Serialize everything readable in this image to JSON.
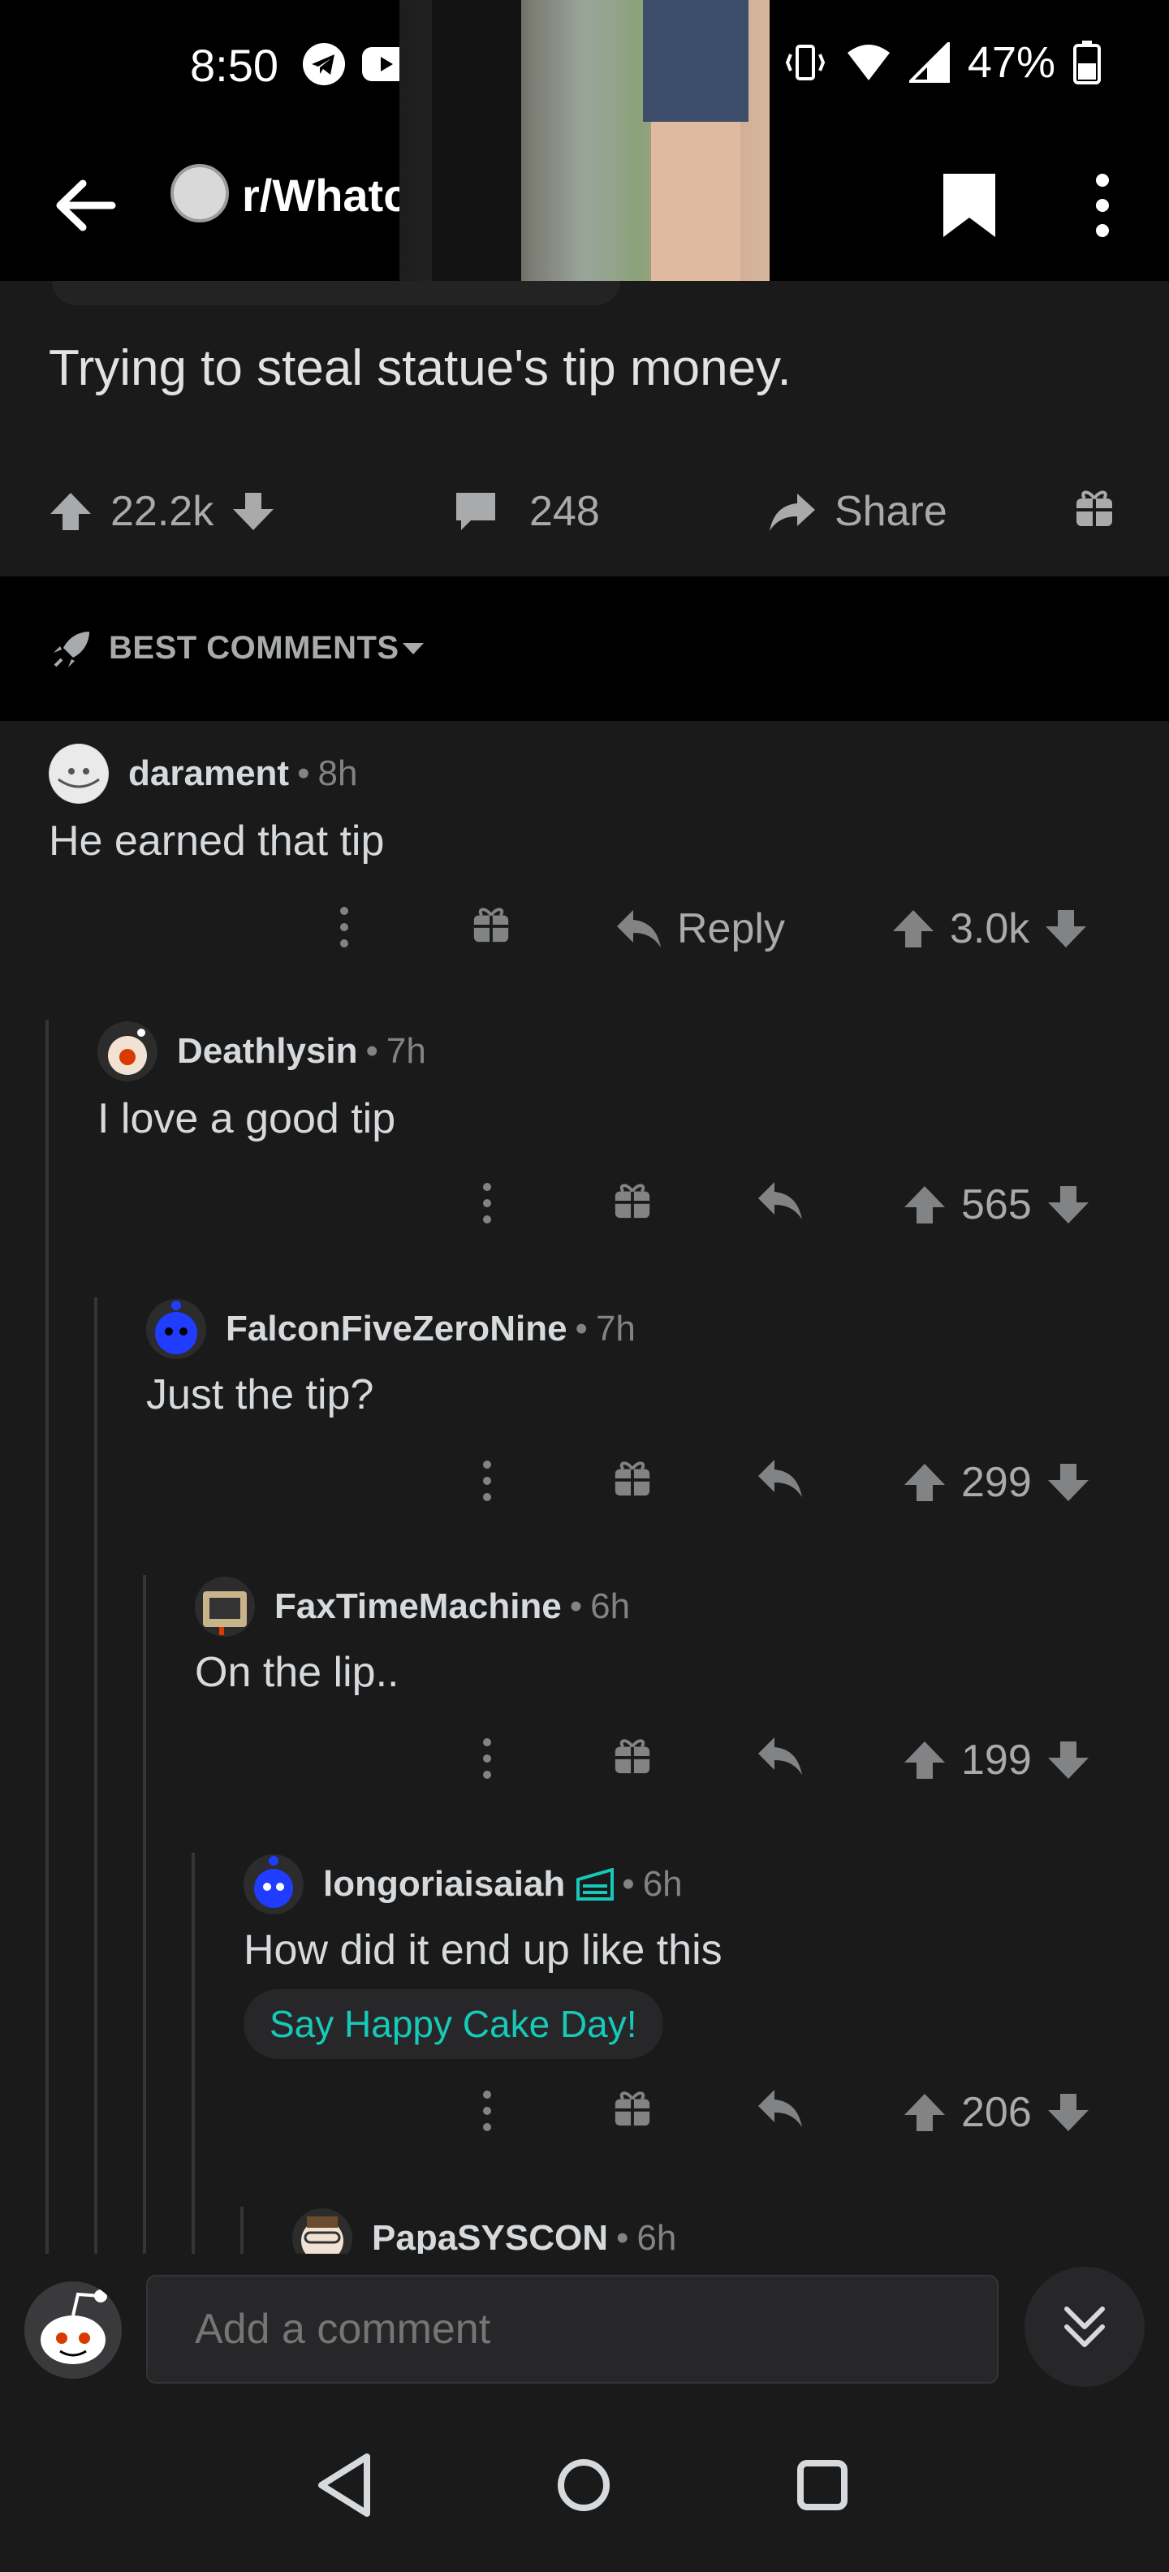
{
  "status_bar": {
    "time": "8:50",
    "battery": "47%",
    "notification_icons": [
      "telegram-icon",
      "youtube-icon",
      "youtube-icon",
      "youtube-icon",
      "dot-icon"
    ],
    "system_icons": [
      "nfc-icon",
      "volte-icon",
      "vibrate-icon",
      "wifi-icon",
      "signal-icon",
      "battery-icon"
    ]
  },
  "header": {
    "subreddit": "r/Whatcouldgowrong"
  },
  "post": {
    "title": "Trying to steal statue's tip money.",
    "score": "22.2k",
    "comment_count": "248",
    "share_label": "Share"
  },
  "sort": {
    "label": "BEST COMMENTS"
  },
  "comments": [
    {
      "author": "darament",
      "age": "8h",
      "body": "He earned that tip",
      "reply_label": "Reply",
      "score": "3.0k"
    },
    {
      "author": "Deathlysin",
      "age": "7h",
      "body": "I love a good tip",
      "score": "565"
    },
    {
      "author": "FalconFiveZeroNine",
      "age": "7h",
      "body": "Just the tip?",
      "score": "299"
    },
    {
      "author": "FaxTimeMachine",
      "age": "6h",
      "body": "On the lip..",
      "score": "199"
    },
    {
      "author": "longoriaisaiah",
      "age": "6h",
      "body": "How did it end up like this",
      "cake_day_label": "Say Happy Cake Day!",
      "score": "206"
    },
    {
      "author": "PapaSYSCON",
      "age": "6h"
    }
  ],
  "composer": {
    "placeholder": "Add a comment"
  },
  "colors": {
    "background": "#1a1a1b",
    "bar_background": "#000000",
    "text": "#d7dadc",
    "muted": "#818384",
    "cake_day": "#16c9b8"
  }
}
